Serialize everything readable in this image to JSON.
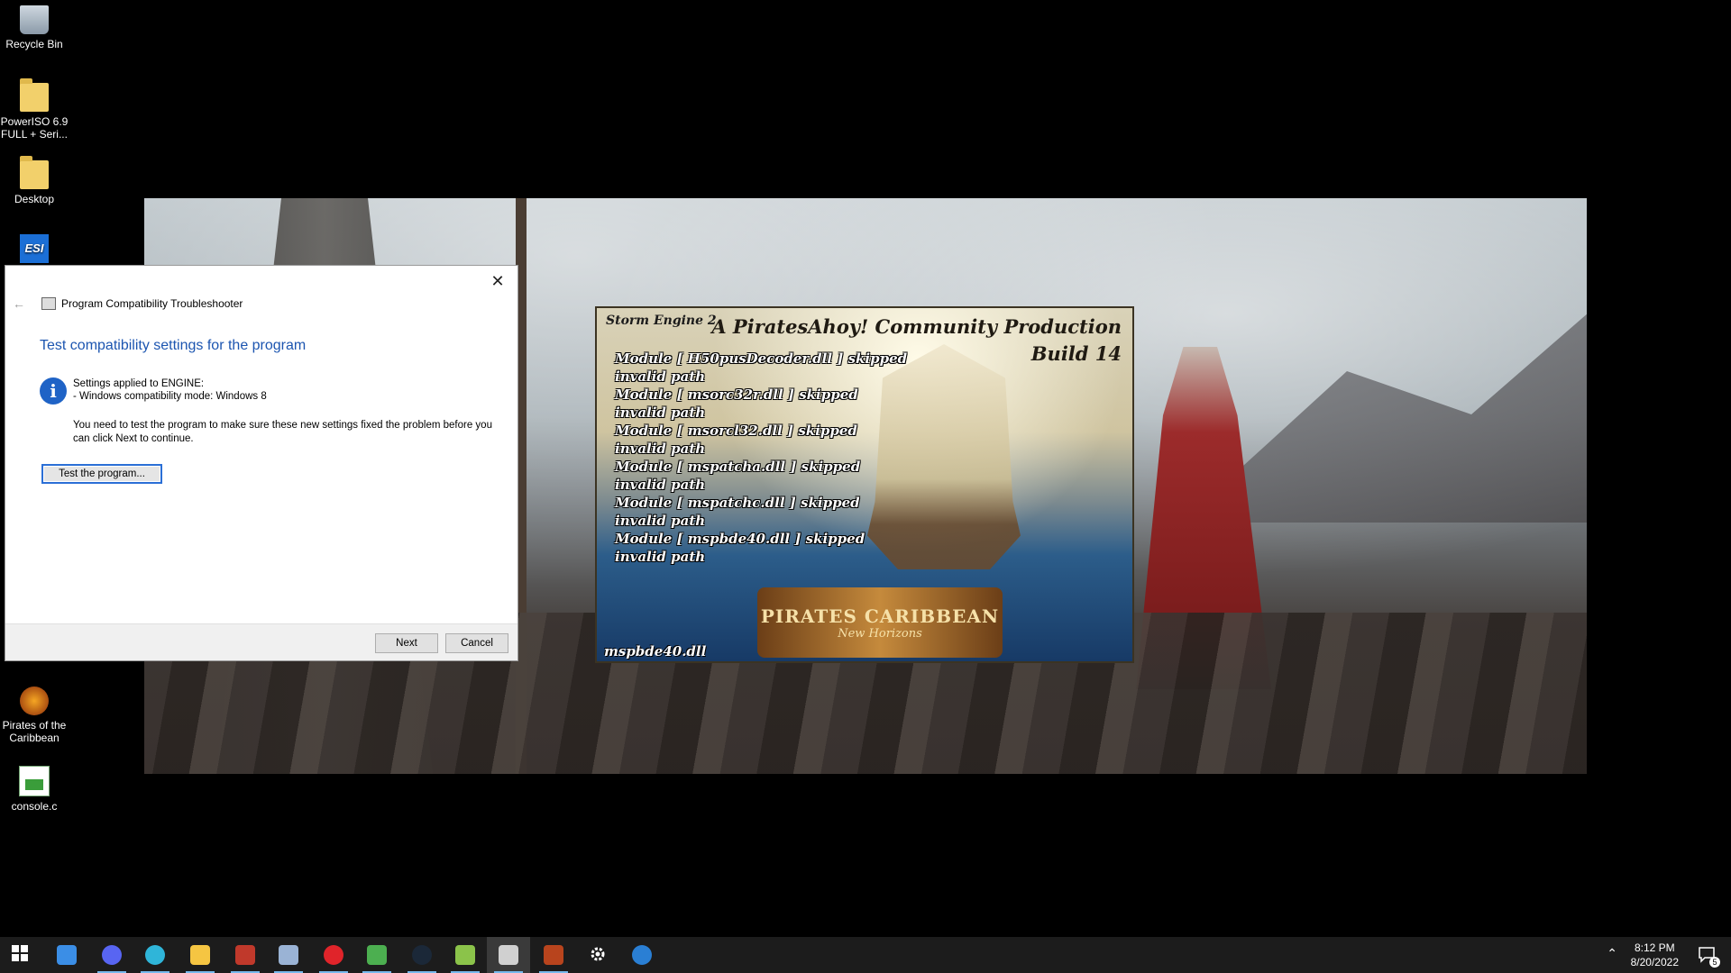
{
  "desktop": {
    "icons": [
      {
        "label": "Recycle Bin"
      },
      {
        "label": "PowerISO 6.9 FULL + Seri..."
      },
      {
        "label": "Desktop"
      },
      {
        "label": "Pirates of the Caribbean"
      },
      {
        "label": "console.c"
      }
    ]
  },
  "splash": {
    "engine": "Storm Engine 2",
    "title": "A PiratesAhoy! Community Production",
    "build": "Build 14",
    "log": [
      "Module [ H50pusDecoder.dll ] skipped",
      "invalid path",
      "Module [ msorc32r.dll ] skipped",
      "invalid path",
      "Module [ msorcl32.dll ] skipped",
      "invalid path",
      "Module [ mspatcha.dll ] skipped",
      "invalid path",
      "Module [ mspatchc.dll ] skipped",
      "invalid path",
      "Module [ mspbde40.dll ] skipped",
      "invalid path"
    ],
    "status_file": "mspbde40.dll",
    "logo_line1": "PIRATES CARIBBEAN",
    "logo_line2": "New Horizons"
  },
  "dialog": {
    "title": "Program Compatibility Troubleshooter",
    "heading": "Test compatibility settings for the program",
    "info_line1": "Settings applied to ENGINE:",
    "info_line2": "- Windows compatibility mode: Windows 8",
    "paragraph": "You need to test the program to make sure these new settings fixed the problem before you can click Next to continue.",
    "test_button": "Test the program...",
    "next_button": "Next",
    "cancel_button": "Cancel",
    "close_glyph": "✕",
    "back_glyph": "←"
  },
  "taskbar": {
    "time": "8:12 PM",
    "date": "8/20/2022",
    "notification_count": "5",
    "apps": [
      {
        "name": "start-icon",
        "color": "#ffffff"
      },
      {
        "name": "store-icon",
        "color": "#3b8ee6"
      },
      {
        "name": "discord-icon",
        "color": "#5865f2"
      },
      {
        "name": "edge-icon",
        "color": "#2fb5d9"
      },
      {
        "name": "file-explorer-icon",
        "color": "#f5c542"
      },
      {
        "name": "msi-afterburner-icon",
        "color": "#c0392b"
      },
      {
        "name": "remote-desktop-icon",
        "color": "#9ab3d5"
      },
      {
        "name": "opera-icon",
        "color": "#e0242a"
      },
      {
        "name": "minecraft-icon",
        "color": "#4caf50"
      },
      {
        "name": "steam-icon",
        "color": "#1b2838"
      },
      {
        "name": "notepad-plus-icon",
        "color": "#8bc34a"
      },
      {
        "name": "troubleshooter-icon",
        "color": "#d0d0d0"
      },
      {
        "name": "potc-game-icon",
        "color": "#b8441d"
      },
      {
        "name": "settings-icon",
        "color": "#ffffff"
      },
      {
        "name": "app-circle-icon",
        "color": "#2a7fd4"
      }
    ]
  }
}
